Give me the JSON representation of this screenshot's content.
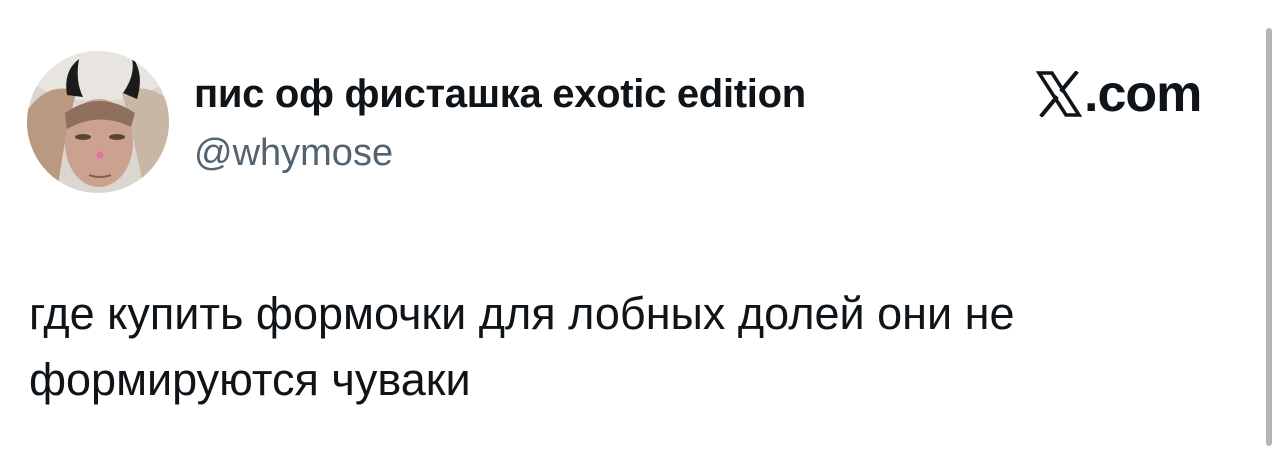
{
  "author": {
    "display_name": "пис оф фисташка exotic edition",
    "handle": "@whymose"
  },
  "brand": {
    "domain": ".com"
  },
  "tweet": {
    "text": "где купить формочки для лобных долей они не формируются чуваки"
  },
  "colors": {
    "text_primary": "#0f1419",
    "text_secondary": "#536471",
    "background": "#ffffff",
    "scrollbar": "#b5b5b5"
  }
}
